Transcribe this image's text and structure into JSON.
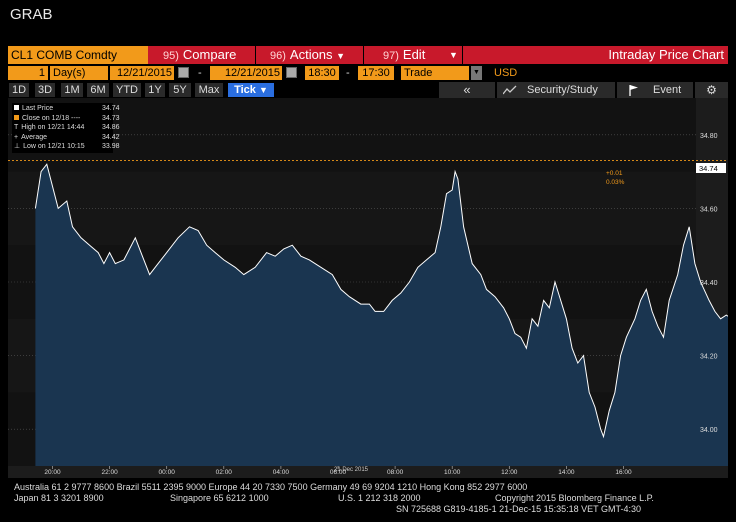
{
  "window_title": "GRAB",
  "toolbar": {
    "security": "CL1 COMB Comdty",
    "compare_num": "95)",
    "compare": "Compare",
    "actions_num": "96)",
    "actions": "Actions",
    "edit_num": "97)",
    "edit": "Edit",
    "chart_title": "Intraday Price Chart"
  },
  "params": {
    "days": "1",
    "days_unit": "Day(s)",
    "start_date": "12/21/2015",
    "dash": "-",
    "end_date": "12/21/2015",
    "start_time": "18:30",
    "dash2": "-",
    "end_time": "17:30",
    "event": "Trade",
    "currency": "USD"
  },
  "ranges": [
    "1D",
    "3D",
    "1M",
    "6M",
    "YTD",
    "1Y",
    "5Y",
    "Max"
  ],
  "tick_label": "Tick",
  "right_buttons": {
    "collapse": "«",
    "security_study": "Security/Study",
    "event": "Event"
  },
  "legend": [
    {
      "label": "Last Price",
      "value": "34.74",
      "color": "#ffffff"
    },
    {
      "label": "Close on 12/18 ----",
      "value": "34.73",
      "color": "#f29a1a"
    },
    {
      "label": "High on 12/21 14:44",
      "value": "34.86",
      "color": "#dddddd"
    },
    {
      "label": "Average",
      "value": "34.42",
      "color": "#dddddd"
    },
    {
      "label": "Low on 12/21 10:15",
      "value": "33.98",
      "color": "#dddddd"
    }
  ],
  "price_tag": "34.74",
  "change_abs": "+0.01",
  "change_pct": "0.03%",
  "chart_data": {
    "type": "area",
    "date_label": "21 Dec 2015",
    "x_ticks": [
      "20:00",
      "22:00",
      "00:00",
      "02:00",
      "04:00",
      "06:00",
      "08:00",
      "10:00",
      "12:00",
      "14:00",
      "16:00"
    ],
    "y_ticks": [
      34.0,
      34.2,
      34.4,
      34.6,
      34.8
    ],
    "ylim": [
      33.9,
      34.9
    ],
    "close_line": 34.73,
    "high": 34.86,
    "low": 33.98,
    "average": 34.42,
    "last": 34.74,
    "series": [
      {
        "values": [
          [
            -0.3,
            34.6
          ],
          [
            -0.2,
            34.7
          ],
          [
            -0.1,
            34.72
          ],
          [
            0.1,
            34.6
          ],
          [
            0.25,
            34.62
          ],
          [
            0.35,
            34.55
          ],
          [
            0.5,
            34.52
          ],
          [
            0.65,
            34.5
          ],
          [
            0.8,
            34.48
          ],
          [
            0.9,
            34.45
          ],
          [
            1.0,
            34.48
          ],
          [
            1.1,
            34.45
          ],
          [
            1.25,
            34.46
          ],
          [
            1.45,
            34.52
          ],
          [
            1.55,
            34.48
          ],
          [
            1.7,
            34.42
          ],
          [
            1.85,
            34.45
          ],
          [
            2.0,
            34.48
          ],
          [
            2.2,
            34.52
          ],
          [
            2.4,
            34.55
          ],
          [
            2.55,
            34.54
          ],
          [
            2.7,
            34.5
          ],
          [
            2.85,
            34.48
          ],
          [
            3.0,
            34.46
          ],
          [
            3.2,
            34.44
          ],
          [
            3.35,
            34.42
          ],
          [
            3.55,
            34.44
          ],
          [
            3.75,
            34.48
          ],
          [
            3.9,
            34.47
          ],
          [
            4.05,
            34.49
          ],
          [
            4.2,
            34.5
          ],
          [
            4.35,
            34.47
          ],
          [
            4.5,
            34.46
          ],
          [
            4.7,
            34.44
          ],
          [
            4.9,
            34.42
          ],
          [
            5.05,
            34.38
          ],
          [
            5.2,
            34.36
          ],
          [
            5.4,
            34.34
          ],
          [
            5.55,
            34.34
          ],
          [
            5.65,
            34.32
          ],
          [
            5.8,
            34.32
          ],
          [
            5.95,
            34.35
          ],
          [
            6.1,
            34.37
          ],
          [
            6.25,
            34.4
          ],
          [
            6.4,
            34.44
          ],
          [
            6.55,
            34.46
          ],
          [
            6.7,
            34.48
          ],
          [
            6.8,
            34.55
          ],
          [
            6.9,
            34.64
          ],
          [
            7.0,
            34.65
          ],
          [
            7.05,
            34.7
          ],
          [
            7.1,
            34.68
          ],
          [
            7.2,
            34.55
          ],
          [
            7.35,
            34.45
          ],
          [
            7.5,
            34.42
          ],
          [
            7.6,
            34.38
          ],
          [
            7.75,
            34.36
          ],
          [
            7.9,
            34.33
          ],
          [
            8.0,
            34.3
          ],
          [
            8.1,
            34.26
          ],
          [
            8.2,
            34.25
          ],
          [
            8.3,
            34.22
          ],
          [
            8.4,
            34.3
          ],
          [
            8.5,
            34.28
          ],
          [
            8.6,
            34.35
          ],
          [
            8.7,
            34.33
          ],
          [
            8.8,
            34.4
          ],
          [
            8.9,
            34.35
          ],
          [
            9.0,
            34.3
          ],
          [
            9.1,
            34.22
          ],
          [
            9.2,
            34.18
          ],
          [
            9.3,
            34.2
          ],
          [
            9.4,
            34.1
          ],
          [
            9.5,
            34.06
          ],
          [
            9.6,
            34.0
          ],
          [
            9.65,
            33.98
          ],
          [
            9.75,
            34.05
          ],
          [
            9.85,
            34.1
          ],
          [
            9.95,
            34.2
          ],
          [
            10.05,
            34.25
          ],
          [
            10.2,
            34.3
          ],
          [
            10.3,
            34.35
          ],
          [
            10.4,
            34.38
          ],
          [
            10.5,
            34.32
          ],
          [
            10.6,
            34.28
          ],
          [
            10.7,
            34.25
          ],
          [
            10.8,
            34.35
          ],
          [
            10.95,
            34.42
          ],
          [
            11.05,
            34.5
          ],
          [
            11.15,
            34.55
          ],
          [
            11.25,
            34.45
          ],
          [
            11.35,
            34.4
          ],
          [
            11.5,
            34.35
          ],
          [
            11.6,
            34.32
          ],
          [
            11.7,
            34.3
          ],
          [
            11.8,
            34.31
          ],
          [
            11.9,
            34.3
          ],
          [
            12.0,
            34.33
          ],
          [
            12.1,
            34.36
          ],
          [
            12.25,
            34.42
          ],
          [
            12.4,
            34.48
          ],
          [
            12.55,
            34.52
          ],
          [
            12.7,
            34.55
          ],
          [
            12.85,
            34.56
          ],
          [
            13.0,
            34.55
          ],
          [
            13.1,
            34.6
          ],
          [
            13.2,
            34.62
          ],
          [
            13.3,
            34.7
          ],
          [
            13.4,
            34.75
          ],
          [
            13.5,
            34.78
          ],
          [
            13.55,
            34.8
          ],
          [
            13.6,
            34.86
          ],
          [
            13.65,
            34.84
          ],
          [
            13.7,
            34.8
          ],
          [
            13.75,
            34.74
          ]
        ]
      }
    ]
  },
  "footer": {
    "line1": "Australia 61 2 9777 8600 Brazil 5511 2395 9000 Europe 44 20 7330 7500 Germany 49 69 9204 1210 Hong Kong 852 2977 6000",
    "line2a": "Japan 81 3 3201 8900",
    "line2b": "Singapore 65 6212 1000",
    "line2c": "U.S. 1 212 318 2000",
    "line2d": "Copyright 2015 Bloomberg Finance L.P.",
    "line3": "SN 725688 G819-4185-1 21-Dec-15 15:35:18 VET GMT-4:30"
  }
}
